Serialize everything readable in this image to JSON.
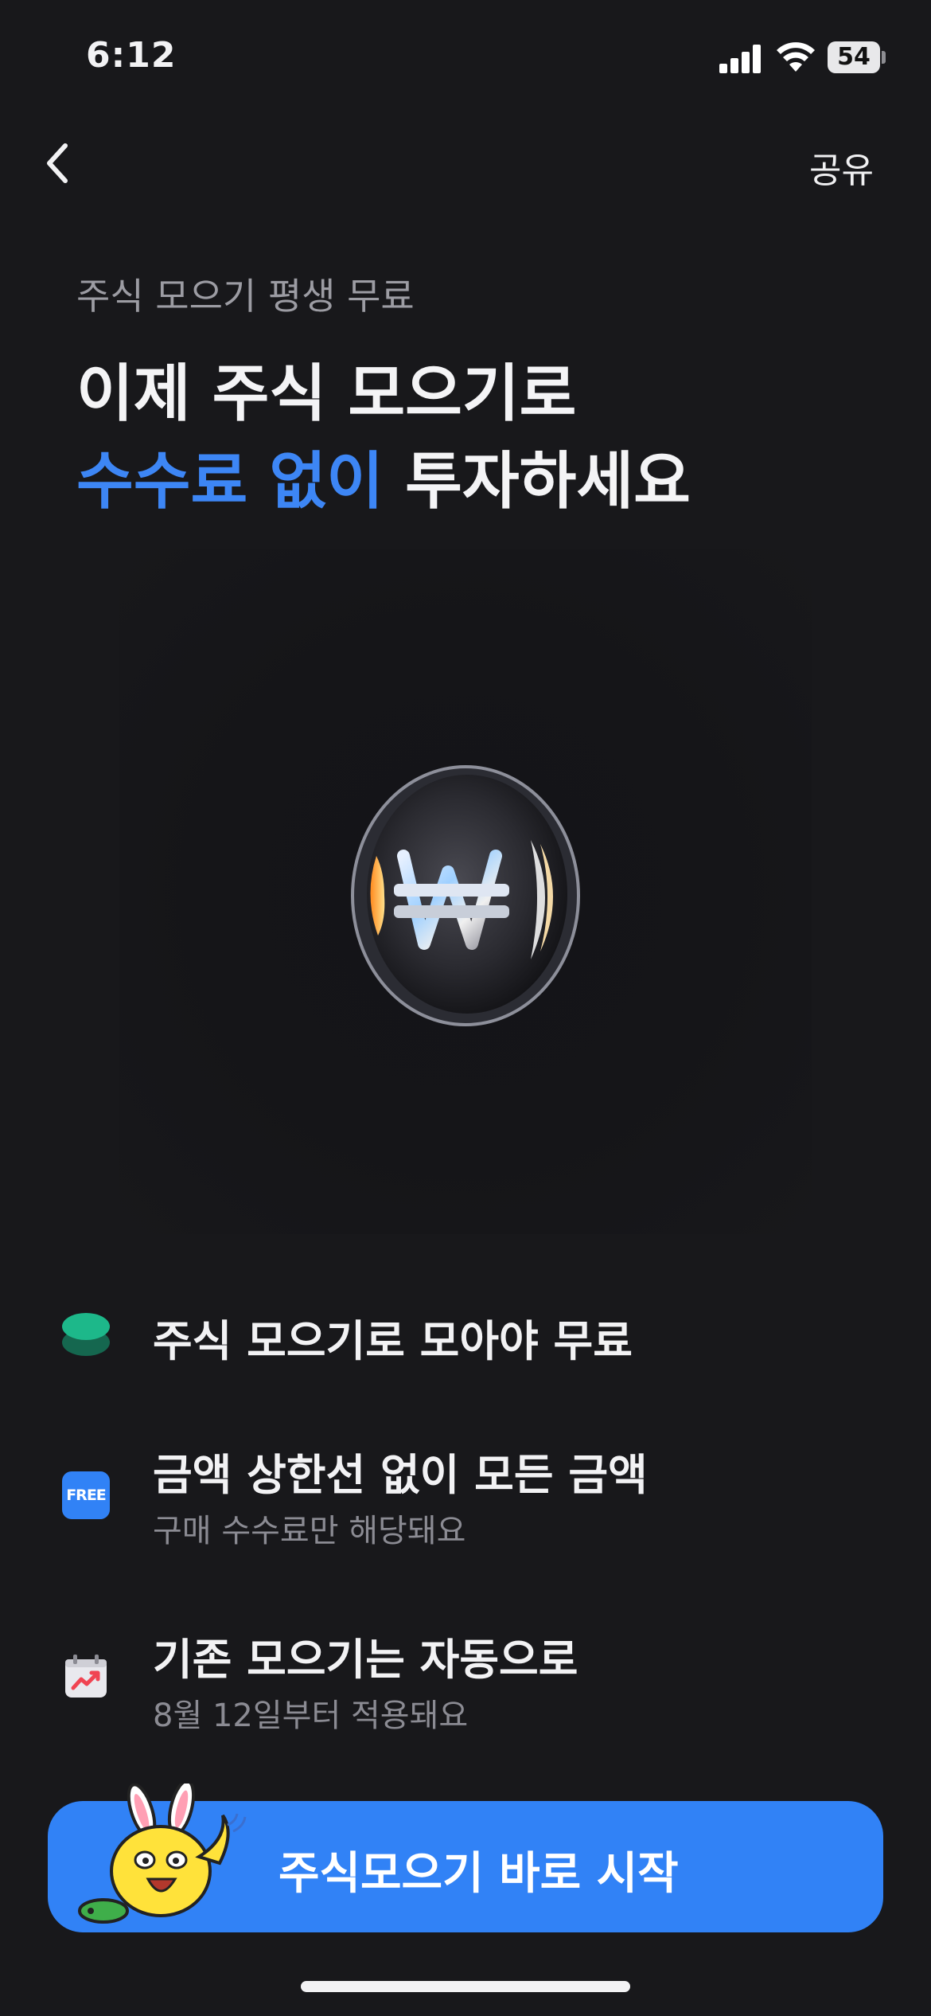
{
  "status": {
    "time": "6:12",
    "battery": "54"
  },
  "nav": {
    "share_label": "공유"
  },
  "header": {
    "eyebrow": "주식 모으기 평생 무료",
    "title_line1": "이제 주식 모으기로",
    "title_accent": "수수료 없이",
    "title_rest": " 투자하세요"
  },
  "hero": {
    "icon": "won-coin-icon"
  },
  "features": [
    {
      "icon": "stack-icon",
      "title": "주식 모으기로 모아야 무료",
      "subtitle": ""
    },
    {
      "icon": "free-badge-icon",
      "badge": "FREE",
      "title": "금액 상한선 없이 모든 금액",
      "subtitle": "구매 수수료만 해당돼요"
    },
    {
      "icon": "calendar-chart-icon",
      "title": "기존 모으기는 자동으로",
      "subtitle": "8월 12일부터 적용돼요"
    }
  ],
  "cta": {
    "label": "주식모으기 바로 시작"
  },
  "colors": {
    "accent": "#3182f6",
    "accent_text": "#3d86f5",
    "background": "#18181b",
    "green": "#1db88a"
  }
}
